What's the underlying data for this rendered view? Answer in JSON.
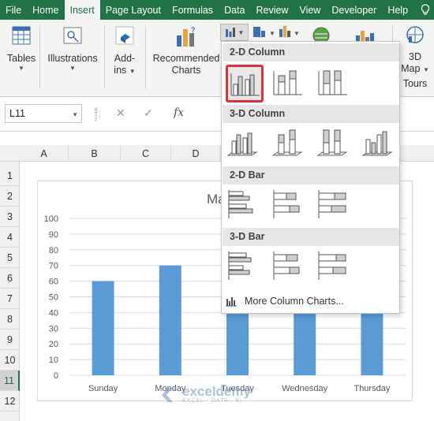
{
  "tabs": [
    {
      "label": "File"
    },
    {
      "label": "Home"
    },
    {
      "label": "Insert"
    },
    {
      "label": "Page Layout"
    },
    {
      "label": "Formulas"
    },
    {
      "label": "Data"
    },
    {
      "label": "Review"
    },
    {
      "label": "View"
    },
    {
      "label": "Developer"
    },
    {
      "label": "Help"
    }
  ],
  "ribbon": {
    "tables": "Tables",
    "illustrations": "Illustrations",
    "addins_line1": "Add-",
    "addins_line2": "ins",
    "recommended_line1": "Recommended",
    "recommended_line2": "Charts",
    "map3d_line1": "3D",
    "map3d_line2": "Map",
    "tours": "Tours"
  },
  "formula_bar": {
    "name_box": "L11",
    "fx": "fx"
  },
  "columns": [
    "A",
    "B",
    "C",
    "D"
  ],
  "rows": [
    "1",
    "2",
    "3",
    "4",
    "5",
    "6",
    "7",
    "8",
    "9",
    "10",
    "11",
    "12"
  ],
  "selected_row": "11",
  "dropdown": {
    "sec_2d_column": "2-D Column",
    "sec_3d_column": "3-D Column",
    "sec_2d_bar": "2-D Bar",
    "sec_3d_bar": "3-D Bar",
    "more": "More Column Charts..."
  },
  "chart_title_visible": "Ma",
  "chart_data": {
    "type": "bar",
    "categories": [
      "Sunday",
      "Monday",
      "Tuesday",
      "Wednesday",
      "Thursday"
    ],
    "values": [
      60,
      70,
      70,
      60,
      60
    ],
    "ylim": [
      0,
      100
    ],
    "yticks": [
      "0",
      "10",
      "20",
      "30",
      "40",
      "50",
      "60",
      "70",
      "80",
      "90",
      "100"
    ],
    "color": "#5b9bd5"
  },
  "watermark": {
    "name": "exceldemy",
    "tagline": "EXCEL · DATA · BI"
  },
  "colors": {
    "accent": "#217346",
    "highlight": "#e0303a"
  }
}
